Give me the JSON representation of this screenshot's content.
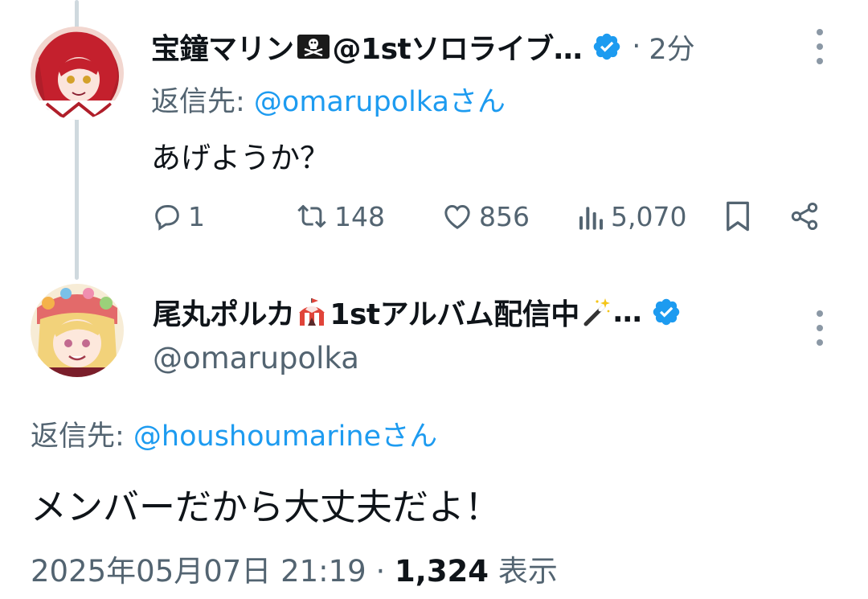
{
  "thread": {
    "parent": {
      "display_name": "宝鐘マリン",
      "name_suffix": "@1stソロライブ…",
      "flag_emoji": "pirate-flag-icon",
      "separator": "·",
      "time": "2分",
      "reply_to_label": "返信先: ",
      "reply_to_handle": "@omarupolkaさん",
      "text": "あげようか？",
      "stats": {
        "replies": "1",
        "retweets": "148",
        "likes": "856",
        "views": "5,070"
      }
    },
    "reply": {
      "display_name": "尾丸ポルカ",
      "name_suffix": "1stアルバム配信中",
      "ellipsis": "…",
      "circus_emoji": "circus-tent-icon",
      "wand_emoji": "magic-wand-icon",
      "handle": "@omarupolka",
      "reply_to_label": "返信先: ",
      "reply_to_handle": "@houshoumarineさん",
      "text": "メンバーだから大丈夫だよ！",
      "timestamp": "2025年05月07日 21:19",
      "separator": "·",
      "view_count": "1,324",
      "view_label": "表示"
    }
  },
  "colors": {
    "accent": "#1d9bf0",
    "secondary_text": "#536471",
    "primary_text": "#0f1419",
    "thread_line": "#cfd9de"
  }
}
